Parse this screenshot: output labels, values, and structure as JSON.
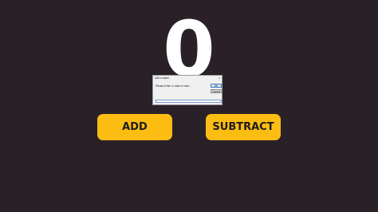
{
  "counter": {
    "value": "0"
  },
  "buttons": {
    "add_label": "ADD",
    "subtract_label": "SUBTRACT"
  },
  "dialog": {
    "title": "Add a value",
    "message": "Please Enter a value to add...",
    "ok_label": "OK",
    "cancel_label": "Cancel",
    "input_value": "",
    "close_glyph": "×"
  },
  "colors": {
    "background": "#2a2128",
    "accent": "#fbbd12",
    "counter_text": "#ffffff",
    "button_text": "#1e1a1f"
  }
}
